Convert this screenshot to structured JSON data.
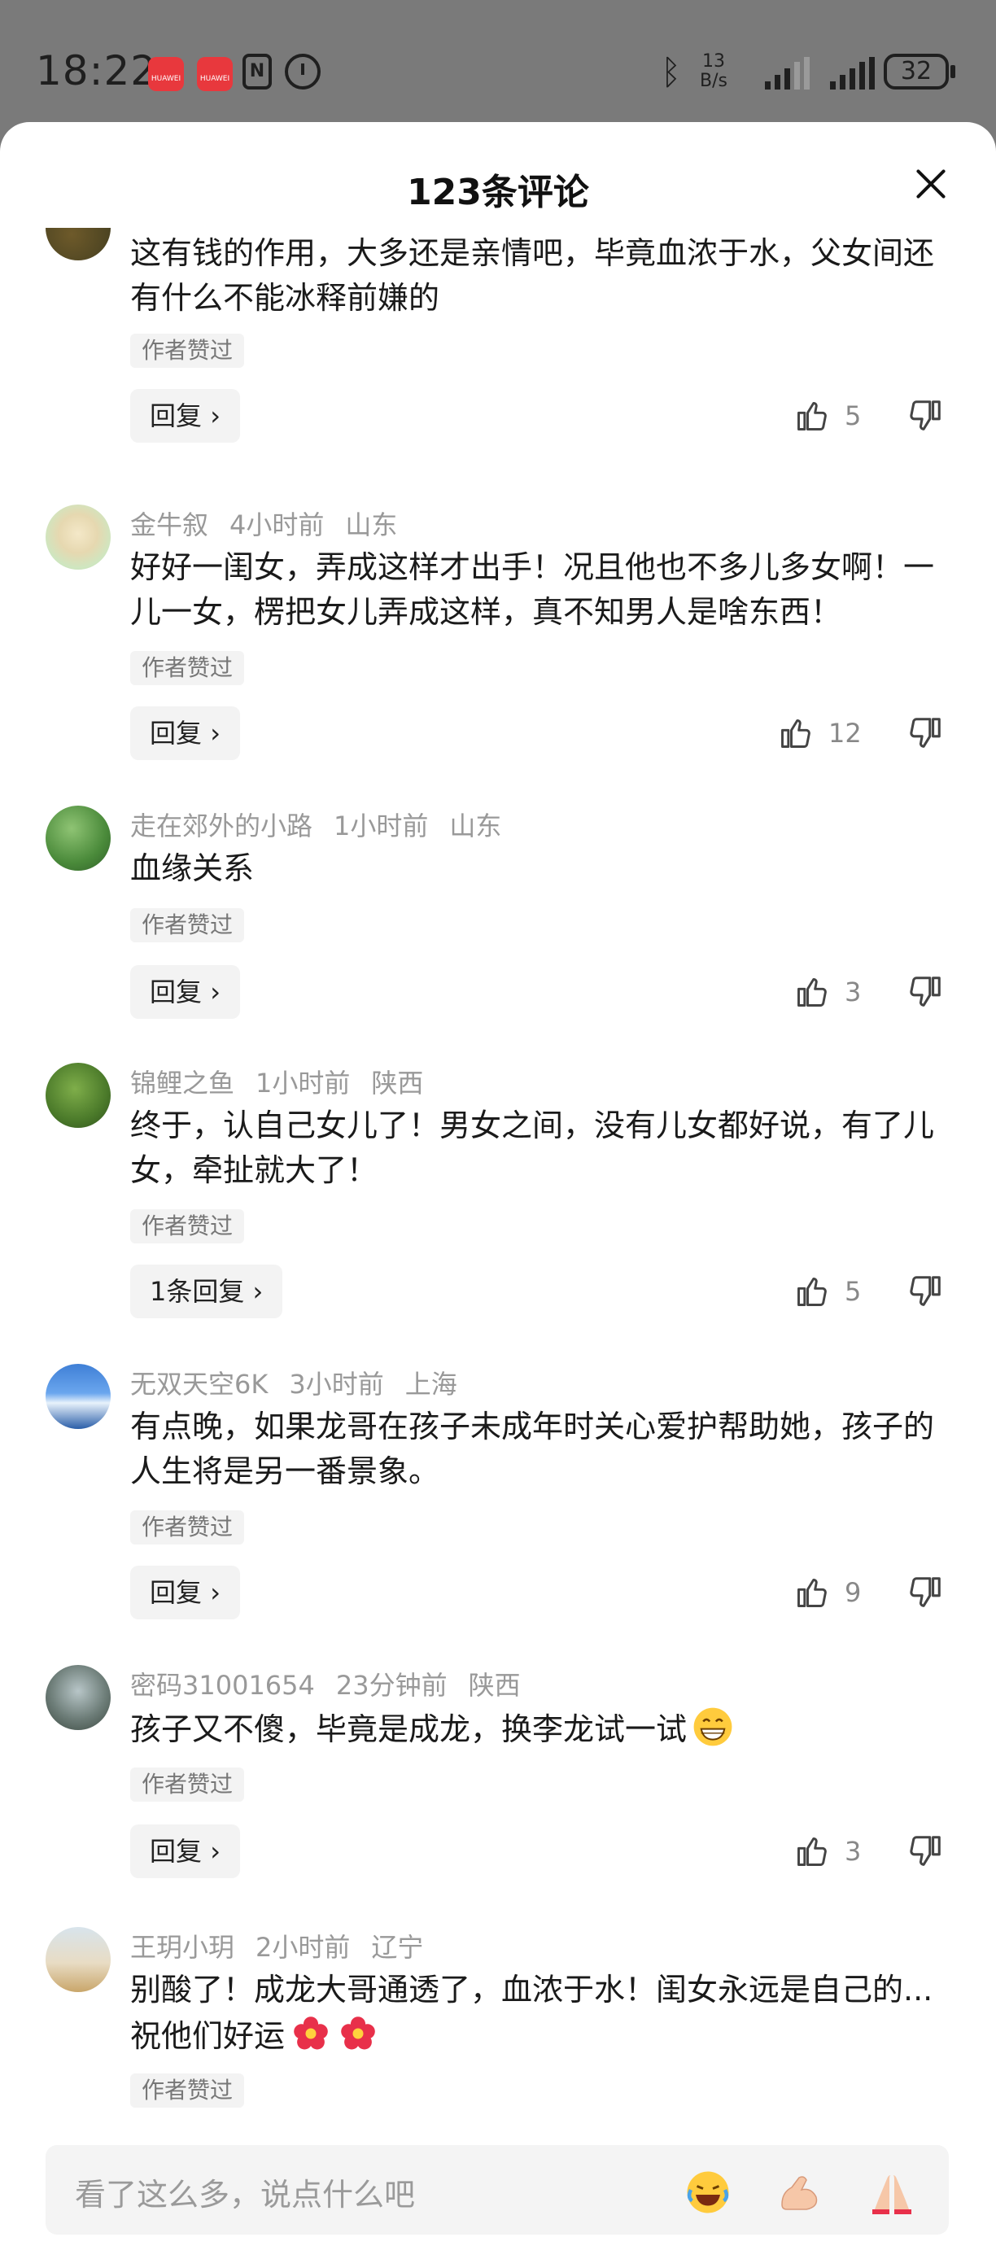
{
  "status_bar": {
    "time": "18:22",
    "app_badge": "HUAWEI",
    "nfc_label": "N",
    "net_speed_value": "13",
    "net_speed_unit": "B/s",
    "battery": "32",
    "icons": [
      "huawei-app-icon",
      "huawei-app-icon",
      "nfc-icon",
      "alarm-icon",
      "bluetooth-icon",
      "signal-icon",
      "signal-icon",
      "battery-icon"
    ]
  },
  "sheet": {
    "title": "123条评论"
  },
  "comments": [
    {
      "text": "这有钱的作用，大多还是亲情吧，毕竟血浓于水，父女间还有什么不能冰释前嫌的",
      "author_tag": "作者赞过",
      "reply_label": "回复",
      "likes": "5"
    },
    {
      "username": "金牛叙",
      "time": "4小时前",
      "location": "山东",
      "text": "好好一闺女，弄成这样才出手！况且他也不多儿多女啊！一儿一女，楞把女儿弄成这样，真不知男人是啥东西！",
      "author_tag": "作者赞过",
      "reply_label": "回复",
      "likes": "12"
    },
    {
      "username": "走在郊外的小路",
      "time": "1小时前",
      "location": "山东",
      "text": "血缘关系",
      "author_tag": "作者赞过",
      "reply_label": "回复",
      "likes": "3"
    },
    {
      "username": "锦鲤之鱼",
      "time": "1小时前",
      "location": "陕西",
      "text": "终于，认自己女儿了！男女之间，没有儿女都好说，有了儿女，牵扯就大了！",
      "author_tag": "作者赞过",
      "reply_label": "1条回复",
      "likes": "5"
    },
    {
      "username": "无双天空6K",
      "time": "3小时前",
      "location": "上海",
      "text": "有点晚，如果龙哥在孩子未成年时关心爱护帮助她，孩子的人生将是另一番景象。",
      "author_tag": "作者赞过",
      "reply_label": "回复",
      "likes": "9"
    },
    {
      "username": "密码31001654",
      "time": "23分钟前",
      "location": "陕西",
      "text": "孩子又不傻，毕竟是成龙，换李龙试一试",
      "emoji": "grin-emoji",
      "author_tag": "作者赞过",
      "reply_label": "回复",
      "likes": "3"
    },
    {
      "username": "王玥小玥",
      "time": "2小时前",
      "location": "辽宁",
      "text": "别酸了！成龙大哥通透了，血浓于水！闺女永远是自己的... 祝他们好运",
      "emoji": "flower-emoji",
      "author_tag": "作者赞过"
    }
  ],
  "input_bar": {
    "placeholder": "看了这么多，说点什么吧",
    "quick_emojis": [
      "laugh-cry-emoji",
      "muscle-emoji",
      "pray-emoji"
    ]
  },
  "colors": {
    "accent_text": "#1a1a1a",
    "meta_text": "#999999",
    "pill_bg": "#f3f3f3",
    "status_bar_bg": "#7a7a7a"
  }
}
